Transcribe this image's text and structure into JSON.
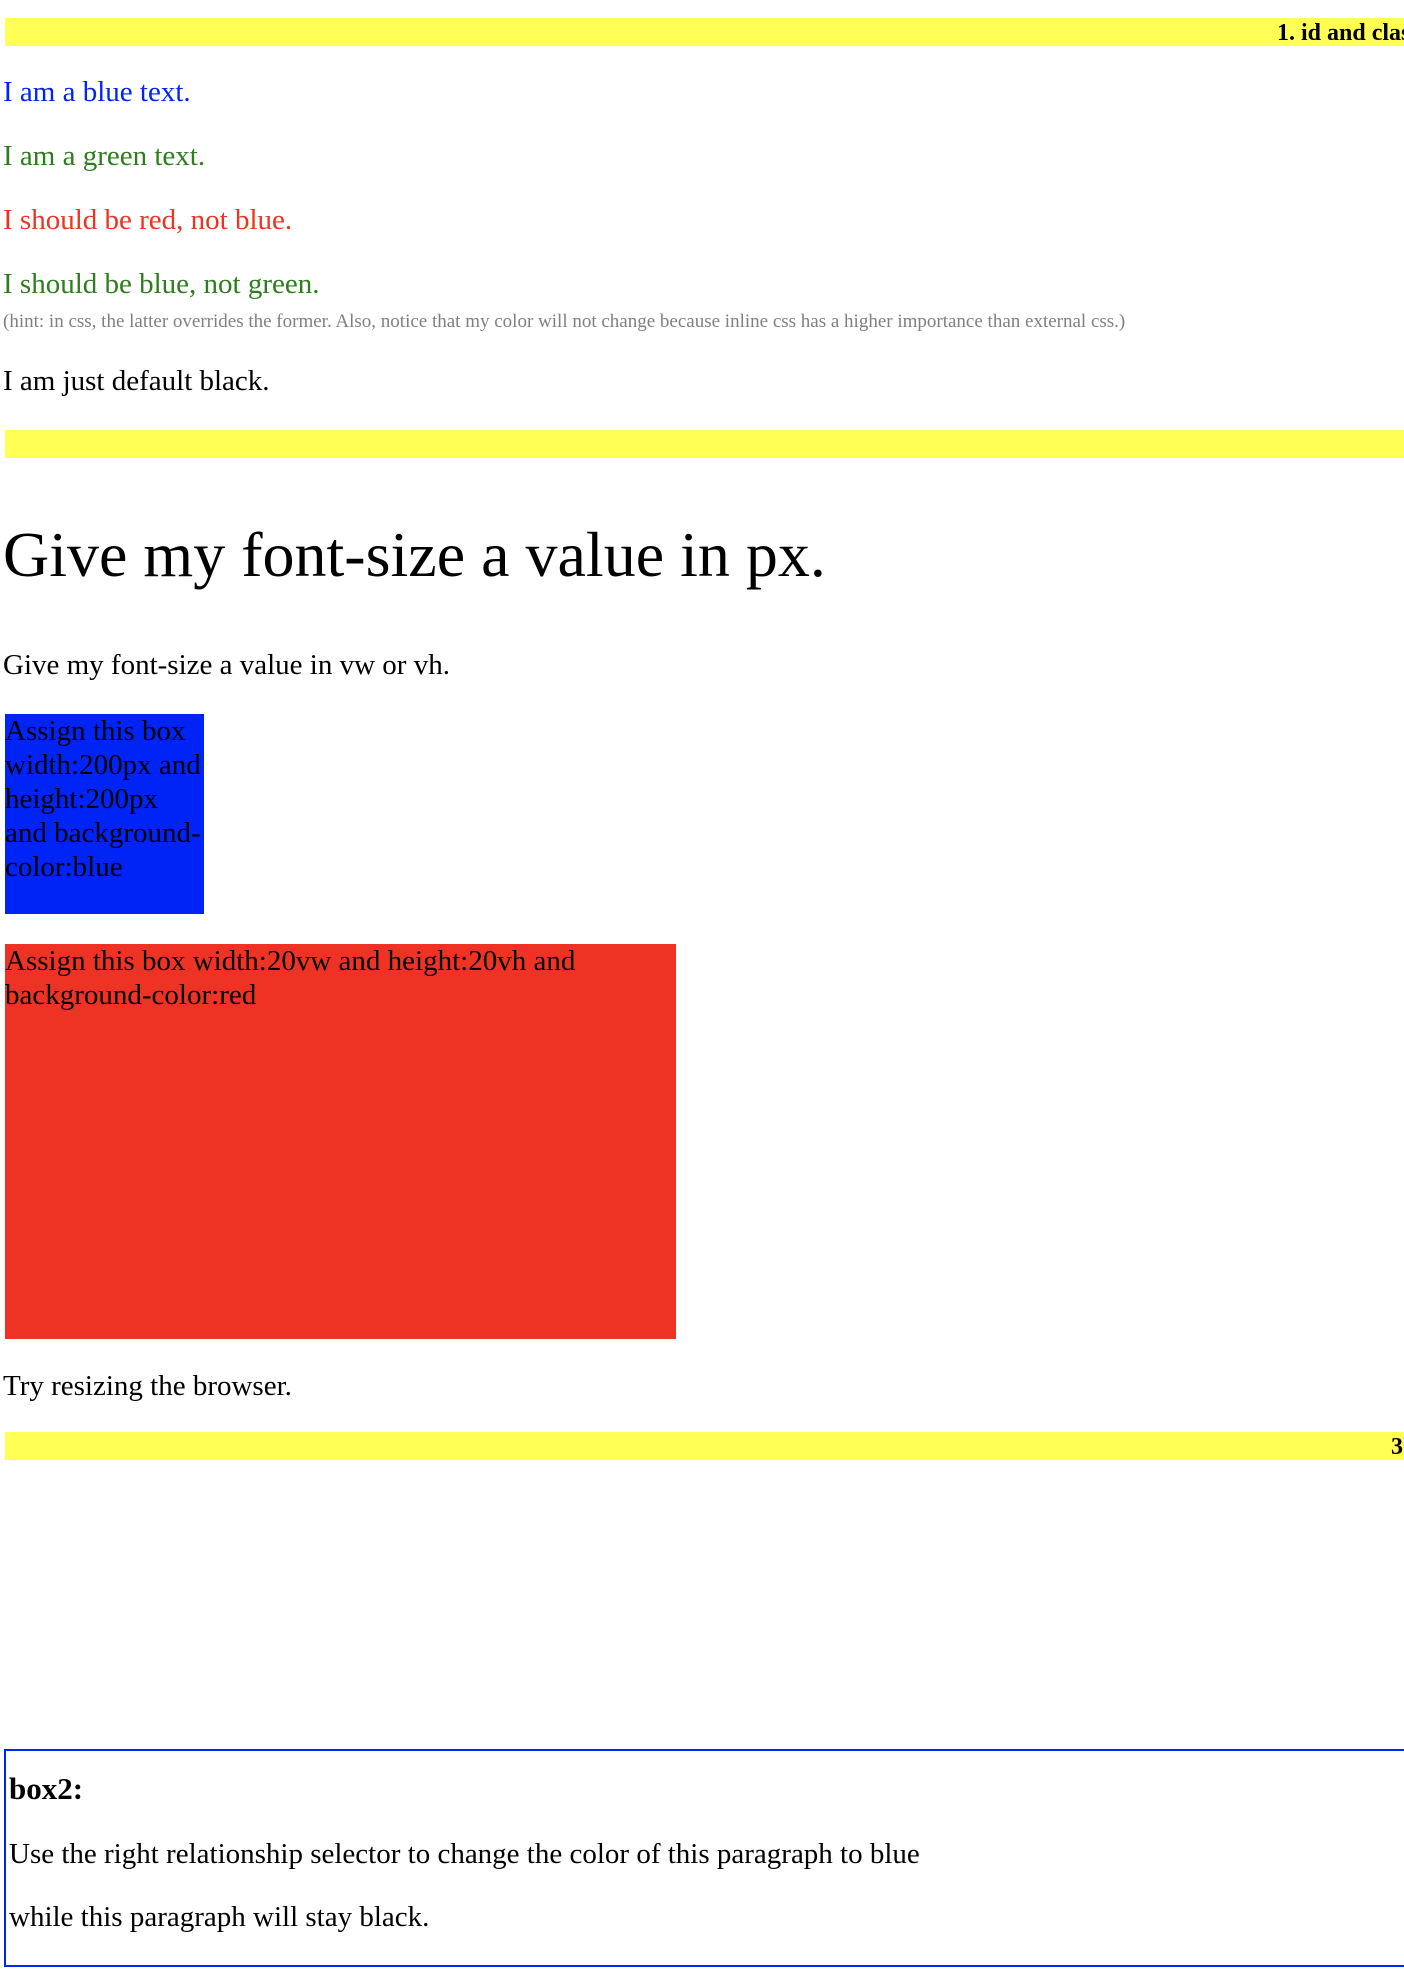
{
  "section1": {
    "title": "1. id and clas",
    "blue_text": "I am a blue text.",
    "green_text": "I am a green text.",
    "red_text": "I should be red, not blue.",
    "blue_not_green": "I should be blue, not green.",
    "hint": "(hint: in css, the latter overrides the former. Also, notice that my color will not change because inline css has a higher importance than external css.)",
    "default_black": "I am just default black."
  },
  "section2": {
    "title": "",
    "px_text": "Give my font-size a value in px.",
    "vw_text": "Give my font-size a value in vw or vh.",
    "blue_box": "Assign this box width:200px and height:200px and background-color:blue",
    "red_box": "Assign this box width:20vw and height:20vh and background-color:red",
    "resize_text": "Try resizing the browser."
  },
  "section3": {
    "title": "3"
  },
  "box2": {
    "title": "box2:",
    "para1": "Use the right relationship selector to change the color of this paragraph to blue",
    "para2": "while this paragraph will stay black."
  },
  "colors": {
    "highlight_bar": "#ffff55",
    "blue": "#0024f5",
    "green": "#2e7d1e",
    "red": "#ee3324",
    "hint_gray": "#808080"
  }
}
